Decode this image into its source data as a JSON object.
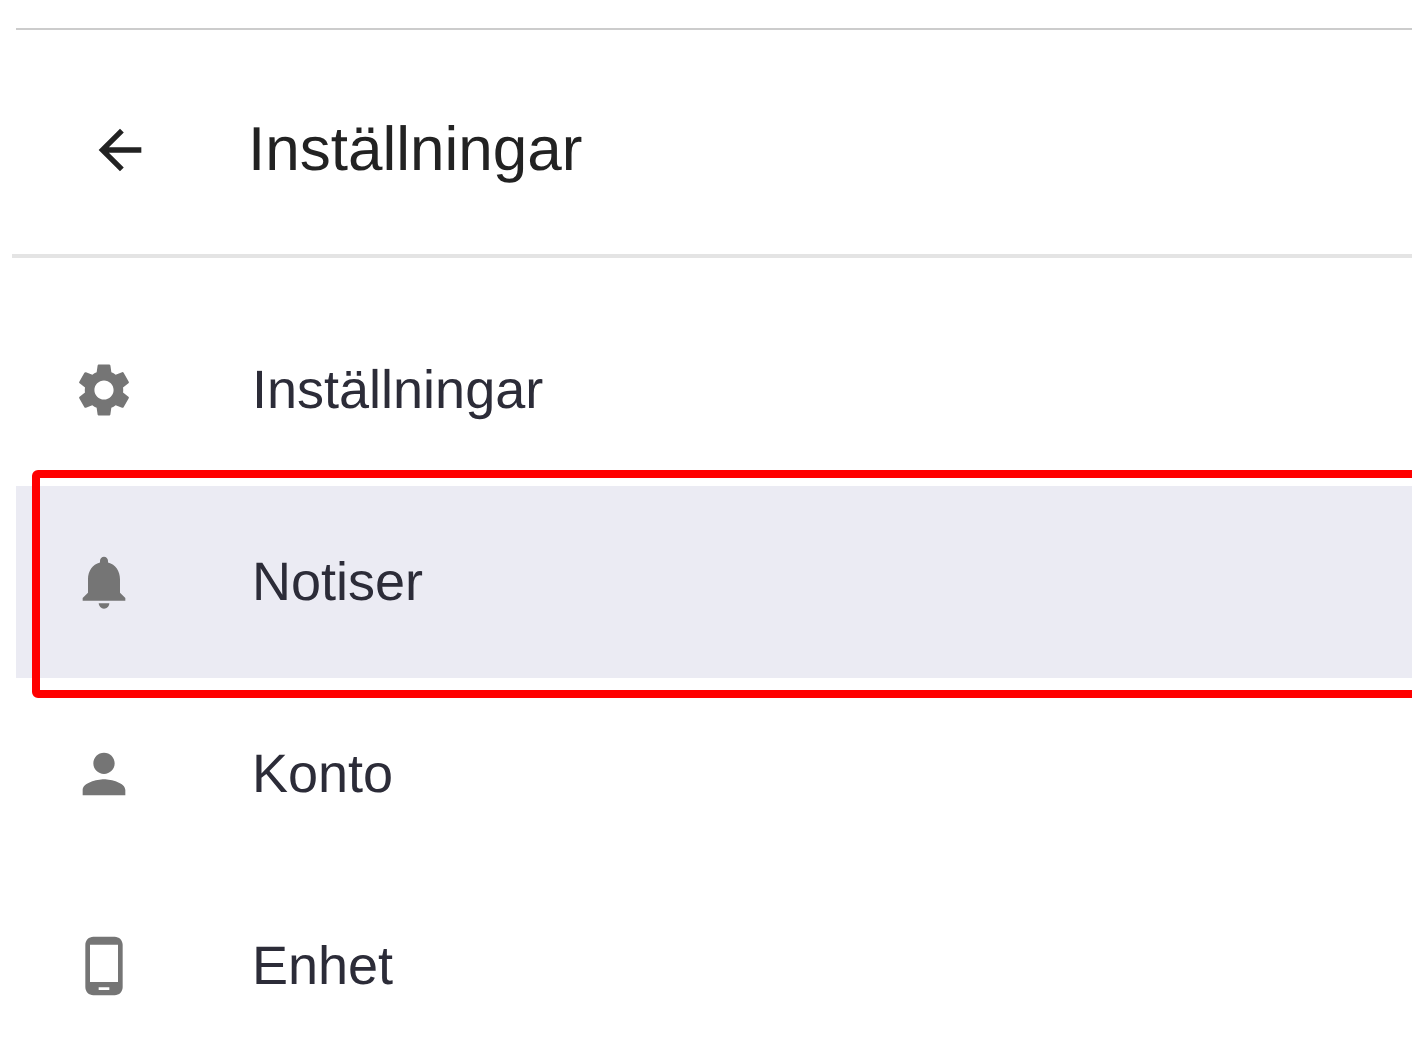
{
  "header": {
    "title": "Inställningar"
  },
  "menu": [
    {
      "kind": "gear",
      "label": "Inställningar",
      "selected": false,
      "highlighted": false
    },
    {
      "kind": "bell",
      "label": "Notiser",
      "selected": true,
      "highlighted": true
    },
    {
      "kind": "person",
      "label": "Konto",
      "selected": false,
      "highlighted": false
    },
    {
      "kind": "phone",
      "label": "Enhet",
      "selected": false,
      "highlighted": false
    }
  ]
}
